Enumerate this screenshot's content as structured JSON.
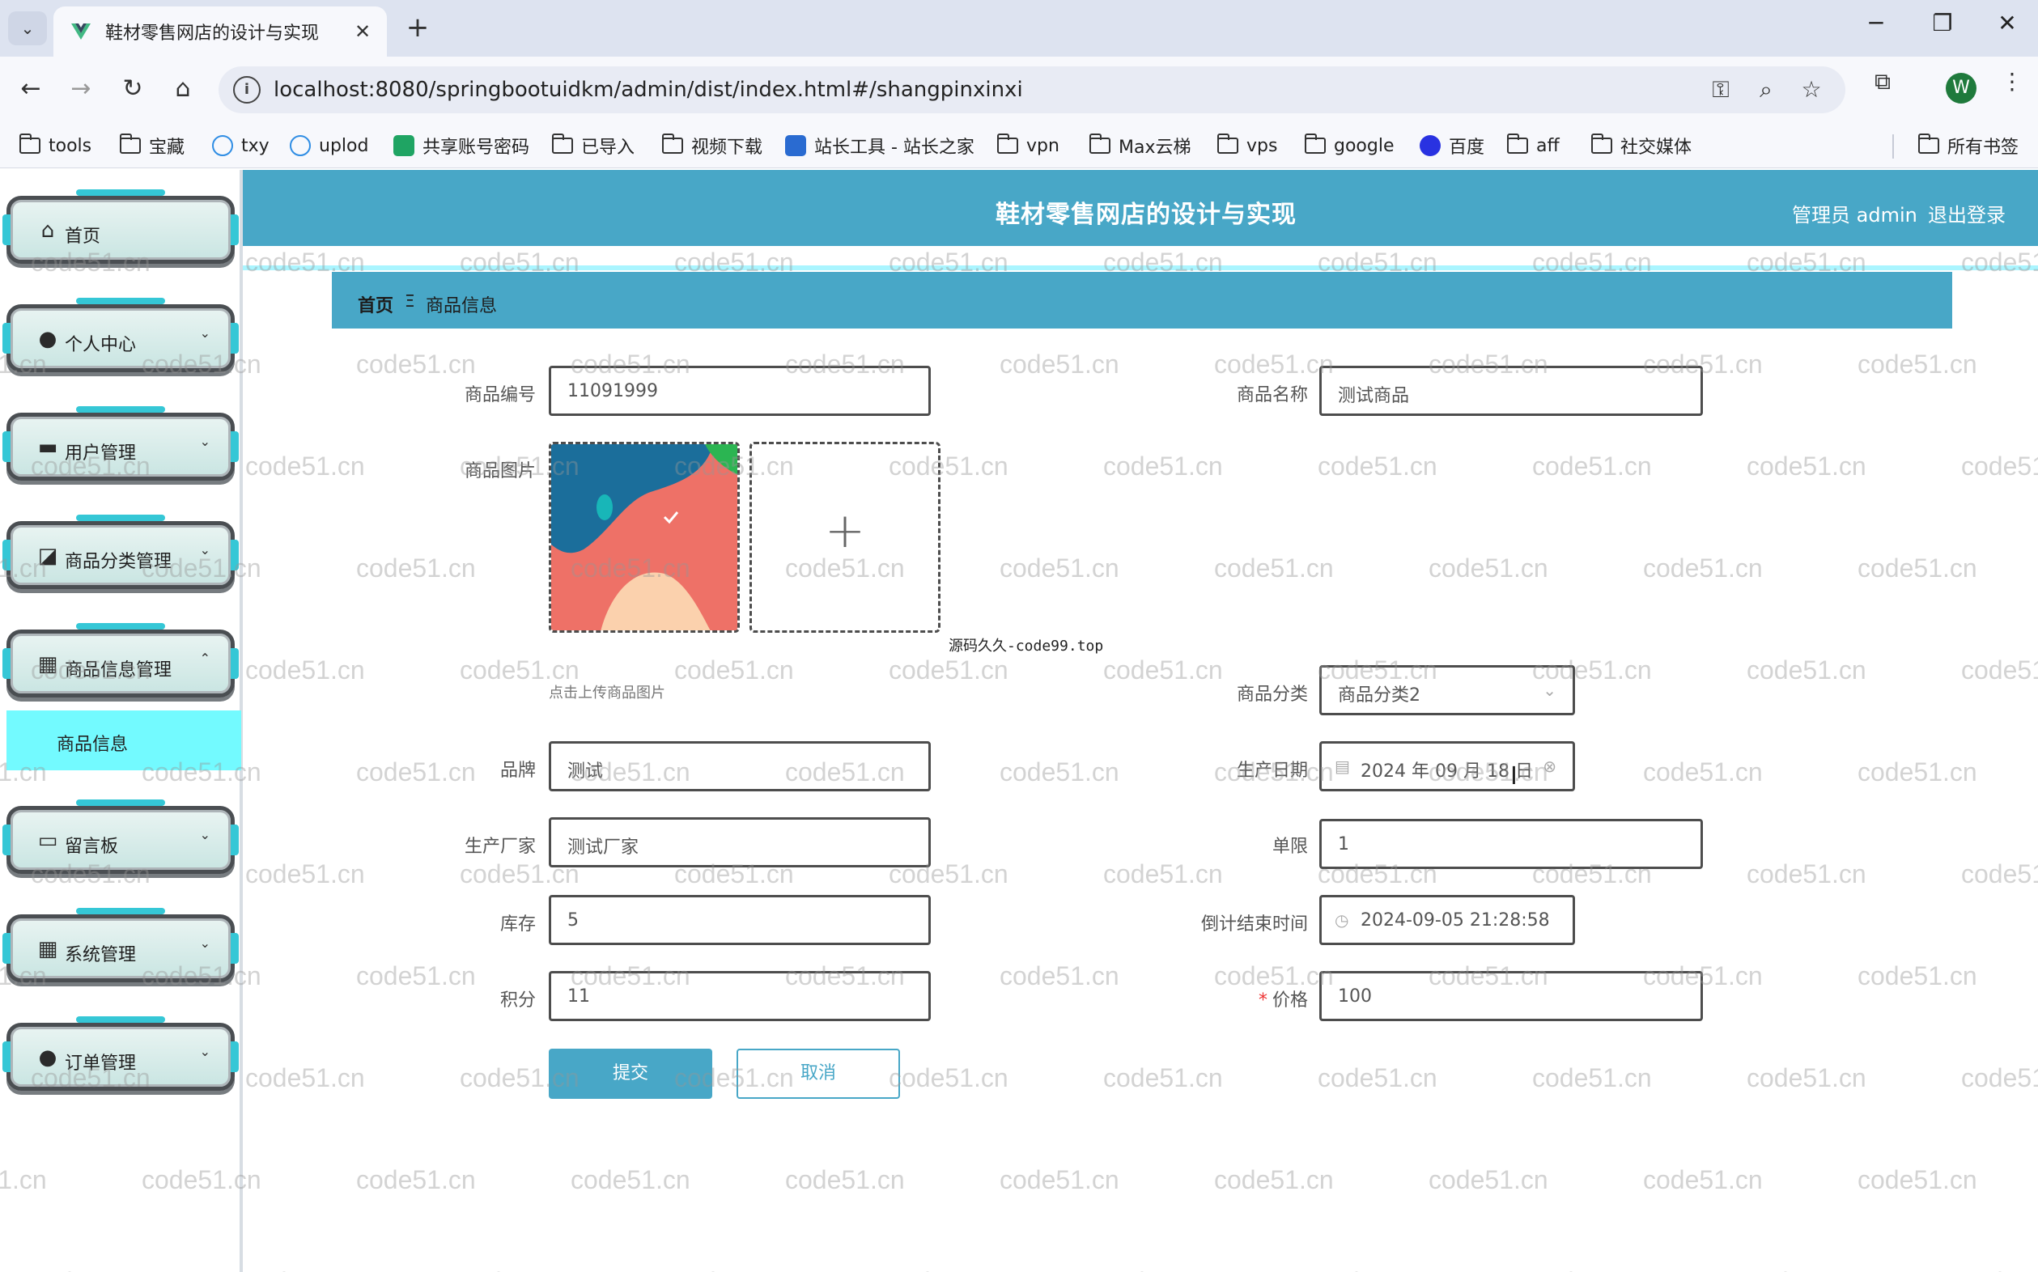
{
  "browser": {
    "tab_title": "鞋材零售网店的设计与实现",
    "url": "localhost:8080/springbootuidkm/admin/dist/index.html#/shangpinxinxi",
    "profile_initial": "W",
    "bookmarks": [
      "tools",
      "宝藏",
      "txy",
      "uplod",
      "共享账号密码",
      "已导入",
      "视频下载",
      "站长工具 - 站长之家",
      "vpn",
      "Max云梯",
      "vps",
      "google",
      "百度",
      "aff",
      "社交媒体"
    ],
    "all_bookmarks": "所有书签"
  },
  "header": {
    "title": "鞋材零售网店的设计与实现",
    "user": "管理员 admin",
    "logout": "退出登录"
  },
  "sidebar": {
    "items": [
      {
        "label": "首页",
        "icon": "home-icon"
      },
      {
        "label": "个人中心",
        "icon": "user-icon"
      },
      {
        "label": "用户管理",
        "icon": "chat-icon"
      },
      {
        "label": "商品分类管理",
        "icon": "chart-icon"
      },
      {
        "label": "商品信息管理",
        "icon": "grid-icon"
      },
      {
        "label": "留言板",
        "icon": "monitor-icon"
      },
      {
        "label": "系统管理",
        "icon": "grid-icon"
      },
      {
        "label": "订单管理",
        "icon": "user-icon"
      }
    ],
    "sub_item": "商品信息"
  },
  "breadcrumb": {
    "home": "首页",
    "separator": "Ξ",
    "current": "商品信息"
  },
  "form": {
    "code_label": "商品编号",
    "code_value": "11091999",
    "name_label": "商品名称",
    "name_value": "测试商品",
    "image_label": "商品图片",
    "upload_tip": "点击上传商品图片",
    "source_note": "源码久久-code99.top",
    "category_label": "商品分类",
    "category_value": "商品分类2",
    "brand_label": "品牌",
    "brand_value": "测试",
    "date_label": "生产日期",
    "date_value": "2024 年 09 月 18 日",
    "maker_label": "生产厂家",
    "maker_value": "测试厂家",
    "limit_label": "单限",
    "limit_value": "1",
    "stock_label": "库存",
    "stock_value": "5",
    "countdown_label": "倒计结束时间",
    "countdown_value": "2024-09-05 21:28:58",
    "points_label": "积分",
    "points_value": "11",
    "price_label": "价格",
    "price_value": "100",
    "submit": "提交",
    "cancel": "取消"
  },
  "watermark": "code51.cn",
  "colors": {
    "accent": "#48a7c7",
    "submenu_active": "#73faff",
    "header_line": "#aaf5ff"
  }
}
